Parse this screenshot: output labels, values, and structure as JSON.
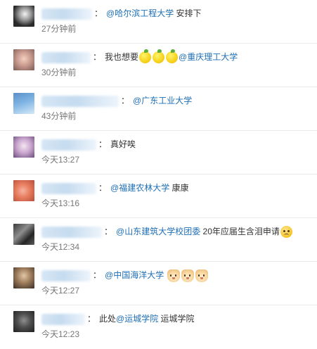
{
  "comments": [
    {
      "avatar": "user-avatar",
      "name_blur_width": 72,
      "segments": [
        {
          "t": "mention",
          "v": "@哈尔滨工程大学"
        },
        {
          "t": "text",
          "v": " 安排下"
        }
      ],
      "time": "27分钟前"
    },
    {
      "avatar": "user-avatar",
      "name_blur_width": 70,
      "segments": [
        {
          "t": "text",
          "v": "我也想要"
        },
        {
          "t": "emoji",
          "v": "lemon-emoji"
        },
        {
          "t": "emoji",
          "v": "lemon-emoji"
        },
        {
          "t": "emoji",
          "v": "lemon-emoji"
        },
        {
          "t": "mention",
          "v": "@重庆理工大学"
        }
      ],
      "time": "30分钟前"
    },
    {
      "avatar": "user-avatar",
      "name_blur_width": 110,
      "segments": [
        {
          "t": "mention",
          "v": "@广东工业大学"
        }
      ],
      "time": "43分钟前"
    },
    {
      "avatar": "user-avatar",
      "name_blur_width": 78,
      "segments": [
        {
          "t": "text",
          "v": "真好唉"
        }
      ],
      "time": "今天13:27"
    },
    {
      "avatar": "user-avatar",
      "name_blur_width": 78,
      "segments": [
        {
          "t": "mention",
          "v": "@福建农林大学"
        },
        {
          "t": "text",
          "v": " 康康"
        }
      ],
      "time": "今天13:16"
    },
    {
      "avatar": "user-avatar",
      "name_blur_width": 86,
      "segments": [
        {
          "t": "mention",
          "v": "@山东建筑大学校团委"
        },
        {
          "t": "text",
          "v": " 20年应届生含泪申请"
        },
        {
          "t": "emoji",
          "v": "sad-emoji"
        }
      ],
      "time": "今天12:34"
    },
    {
      "avatar": "user-avatar",
      "name_blur_width": 70,
      "segments": [
        {
          "t": "mention",
          "v": "@中国海洋大学"
        },
        {
          "t": "text",
          "v": " "
        },
        {
          "t": "emoji",
          "v": "doge-emoji"
        },
        {
          "t": "emoji",
          "v": "doge-emoji"
        },
        {
          "t": "emoji",
          "v": "doge-emoji"
        }
      ],
      "time": "今天12:27"
    },
    {
      "avatar": "user-avatar",
      "name_blur_width": 62,
      "segments": [
        {
          "t": "text",
          "v": "此处"
        },
        {
          "t": "mention",
          "v": "@运城学院"
        },
        {
          "t": "text",
          "v": " 运城学院"
        }
      ],
      "time": "今天12:23"
    }
  ]
}
